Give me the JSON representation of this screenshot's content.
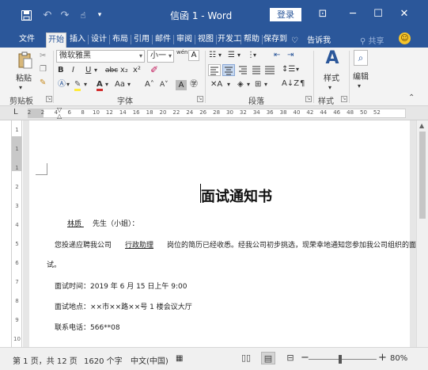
{
  "window": {
    "title": "信函 1  -  Word",
    "login_label": "登录",
    "title_icons": [
      "save-icon",
      "undo-icon",
      "redo-icon",
      "touch-mode-icon",
      "customize-qat-icon"
    ],
    "min": "─",
    "max": "☐",
    "close": "✕",
    "ribbon_display": "⊡"
  },
  "tabs": [
    "文件",
    "开始",
    "插入",
    "设计",
    "布局",
    "引用",
    "邮件",
    "审阅",
    "视图",
    "开发工",
    "帮助",
    "保存到"
  ],
  "active_tab": "开始",
  "tell_me": "告诉我",
  "share": "共享",
  "ribbon": {
    "paste_label": "粘贴",
    "clipboard_label": "剪贴板",
    "font_name": "微软雅黑",
    "font_size": "小一",
    "font_label": "字体",
    "paragraph_label": "段落",
    "styles_label": "样式",
    "styles_group_label": "样式",
    "editing_label": "编辑",
    "bold": "B",
    "italic": "I",
    "underline": "U",
    "strike": "abc",
    "sub": "x₂",
    "sup": "x²",
    "aa": "Aa",
    "grow": "A˄",
    "shrink": "A˅",
    "wen_a": "wén",
    "char_border": "A"
  },
  "ruler": {
    "corner": "L",
    "ticks": [
      "2",
      "2",
      "4",
      "6",
      "8",
      "10",
      "12",
      "14",
      "16",
      "18",
      "20",
      "22",
      "24",
      "26",
      "28",
      "30",
      "32",
      "34",
      "36",
      "38",
      "40",
      "42",
      "44",
      "46",
      "48",
      "50",
      "52"
    ],
    "vticks": [
      "1",
      "1",
      "1",
      "2",
      "3",
      "4",
      "5",
      "6",
      "7",
      "8",
      "9",
      "10"
    ]
  },
  "document": {
    "heading": "面试通知书",
    "salutation_name": "林质",
    "salutation_rest": "先生（小姐）：",
    "body_prefix": "您投递应聘我公司",
    "position": "行政助理",
    "body_suffix": "岗位的简历已经收悉。经我公司初步挑选，现荣幸地通知您参加我公司组织的面",
    "body_cont": "试。",
    "time": "面试时间：2019 年 6 月 15 日上午 9:00",
    "place": "面试地点：××市××路××号 1 楼会议大厅",
    "phone": "联系电话：566**08"
  },
  "status": {
    "page": "第 1 页，共 12 页",
    "words": "1620 个字",
    "lang": "中文(中国)",
    "zoom": "80%",
    "zoom_minus": "−",
    "zoom_plus": "+"
  }
}
